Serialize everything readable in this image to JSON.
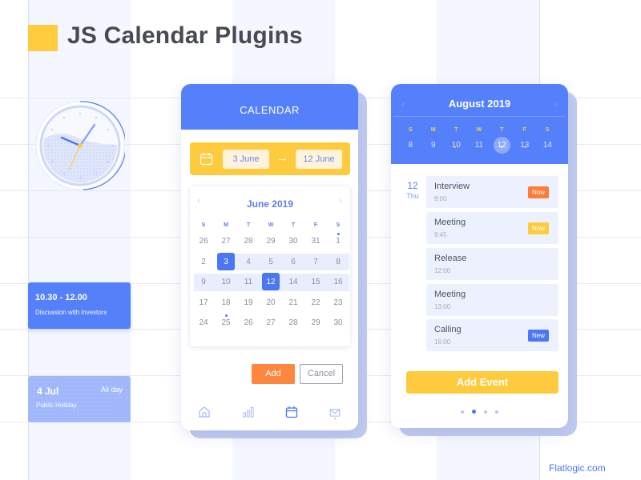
{
  "page": {
    "title": "JS Calendar Plugins",
    "brand": "Flatlogic.com"
  },
  "colors": {
    "primary": "#5580fb",
    "accent_yellow": "#ffcb3e",
    "accent_orange": "#fe873f",
    "stripe": "#f4f7ff"
  },
  "clock": {
    "icon": "clock-icon",
    "hour_hand": "~10",
    "minute_hand": "~7"
  },
  "left_events": [
    {
      "time": "10.30 - 12.00",
      "description": "Discussion with investors"
    },
    {
      "date": "4 Jul",
      "allday": "All day",
      "description": "Public Holiday"
    }
  ],
  "calendar_card": {
    "header": "CALENDAR",
    "range": {
      "icon": "calendar-icon",
      "from": "3 June",
      "arrow": "→",
      "to": "12 June"
    },
    "mini_calendar": {
      "prev": "‹",
      "next": "›",
      "month": "June 2019",
      "weekdays": [
        "S",
        "M",
        "T",
        "W",
        "T",
        "F",
        "S"
      ],
      "weeks": [
        [
          "26",
          "27",
          "28",
          "29",
          "30",
          "31",
          "1"
        ],
        [
          "2",
          "3",
          "4",
          "5",
          "6",
          "7",
          "8"
        ],
        [
          "9",
          "10",
          "11",
          "12",
          "14",
          "15",
          "16"
        ],
        [
          "17",
          "18",
          "19",
          "20",
          "21",
          "22",
          "23"
        ],
        [
          "24",
          "25",
          "26",
          "27",
          "28",
          "29",
          "30"
        ]
      ],
      "selected_start": "3",
      "selected_end": "12"
    },
    "buttons": {
      "add": "Add",
      "cancel": "Cancel"
    },
    "nav": [
      "home-icon",
      "chart-icon",
      "calendar-icon",
      "mail-icon"
    ],
    "nav_active": "calendar-icon"
  },
  "agenda_card": {
    "prev": "‹",
    "next": "›",
    "month": "August 2019",
    "weekdays": [
      "S",
      "M",
      "T",
      "W",
      "T",
      "F",
      "S"
    ],
    "dates": [
      "8",
      "9",
      "10",
      "11",
      "12",
      "13",
      "14"
    ],
    "today": "12",
    "selected_day": {
      "day": "12",
      "weekday": "Thu"
    },
    "events": [
      {
        "title": "Interview",
        "time": "9:00",
        "badge": "Now",
        "badge_color": "#fe7b3a"
      },
      {
        "title": "Meeting",
        "time": "9:45",
        "badge": "Now",
        "badge_color": "#ffcb3e"
      },
      {
        "title": "Release",
        "time": "12:00",
        "badge": null
      },
      {
        "title": "Meeting",
        "time": "13:00",
        "badge": null
      },
      {
        "title": "Calling",
        "time": "16:00",
        "badge": "New",
        "badge_color": "#4b77f4"
      }
    ],
    "add_event_label": "Add Event",
    "pager": {
      "count": 4,
      "active_index": 1
    }
  }
}
